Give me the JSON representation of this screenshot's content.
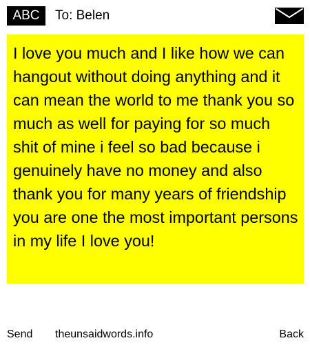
{
  "header": {
    "badge_label": "ABC",
    "recipient_label": "To: Belen",
    "icon": "envelope-icon"
  },
  "message": {
    "text": "I love you much and I like how we can hangout without doing anything and it can mean the world to me thank you so much as well for paying for so much shit of mine i feel so bad because i genuinely have no money and also thank you for many years of friendship you are one the most important persons in my life I love you!",
    "background_color": "#ffff00"
  },
  "footer": {
    "send_label": "Send",
    "site_label": "theunsaidwords.info",
    "back_label": "Back"
  }
}
